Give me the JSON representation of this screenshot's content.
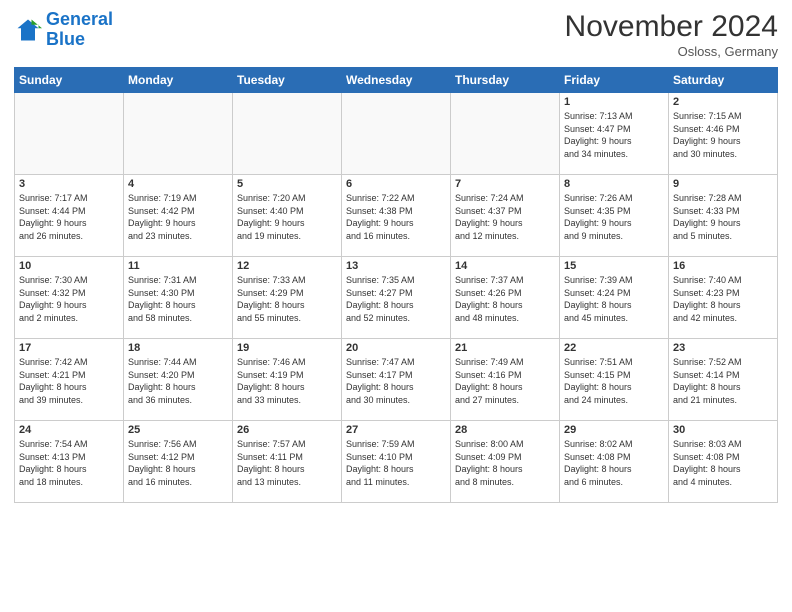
{
  "header": {
    "logo_line1": "General",
    "logo_line2": "Blue",
    "month": "November 2024",
    "location": "Osloss, Germany"
  },
  "weekdays": [
    "Sunday",
    "Monday",
    "Tuesday",
    "Wednesday",
    "Thursday",
    "Friday",
    "Saturday"
  ],
  "weeks": [
    [
      {
        "day": "",
        "info": ""
      },
      {
        "day": "",
        "info": ""
      },
      {
        "day": "",
        "info": ""
      },
      {
        "day": "",
        "info": ""
      },
      {
        "day": "",
        "info": ""
      },
      {
        "day": "1",
        "info": "Sunrise: 7:13 AM\nSunset: 4:47 PM\nDaylight: 9 hours\nand 34 minutes."
      },
      {
        "day": "2",
        "info": "Sunrise: 7:15 AM\nSunset: 4:46 PM\nDaylight: 9 hours\nand 30 minutes."
      }
    ],
    [
      {
        "day": "3",
        "info": "Sunrise: 7:17 AM\nSunset: 4:44 PM\nDaylight: 9 hours\nand 26 minutes."
      },
      {
        "day": "4",
        "info": "Sunrise: 7:19 AM\nSunset: 4:42 PM\nDaylight: 9 hours\nand 23 minutes."
      },
      {
        "day": "5",
        "info": "Sunrise: 7:20 AM\nSunset: 4:40 PM\nDaylight: 9 hours\nand 19 minutes."
      },
      {
        "day": "6",
        "info": "Sunrise: 7:22 AM\nSunset: 4:38 PM\nDaylight: 9 hours\nand 16 minutes."
      },
      {
        "day": "7",
        "info": "Sunrise: 7:24 AM\nSunset: 4:37 PM\nDaylight: 9 hours\nand 12 minutes."
      },
      {
        "day": "8",
        "info": "Sunrise: 7:26 AM\nSunset: 4:35 PM\nDaylight: 9 hours\nand 9 minutes."
      },
      {
        "day": "9",
        "info": "Sunrise: 7:28 AM\nSunset: 4:33 PM\nDaylight: 9 hours\nand 5 minutes."
      }
    ],
    [
      {
        "day": "10",
        "info": "Sunrise: 7:30 AM\nSunset: 4:32 PM\nDaylight: 9 hours\nand 2 minutes."
      },
      {
        "day": "11",
        "info": "Sunrise: 7:31 AM\nSunset: 4:30 PM\nDaylight: 8 hours\nand 58 minutes."
      },
      {
        "day": "12",
        "info": "Sunrise: 7:33 AM\nSunset: 4:29 PM\nDaylight: 8 hours\nand 55 minutes."
      },
      {
        "day": "13",
        "info": "Sunrise: 7:35 AM\nSunset: 4:27 PM\nDaylight: 8 hours\nand 52 minutes."
      },
      {
        "day": "14",
        "info": "Sunrise: 7:37 AM\nSunset: 4:26 PM\nDaylight: 8 hours\nand 48 minutes."
      },
      {
        "day": "15",
        "info": "Sunrise: 7:39 AM\nSunset: 4:24 PM\nDaylight: 8 hours\nand 45 minutes."
      },
      {
        "day": "16",
        "info": "Sunrise: 7:40 AM\nSunset: 4:23 PM\nDaylight: 8 hours\nand 42 minutes."
      }
    ],
    [
      {
        "day": "17",
        "info": "Sunrise: 7:42 AM\nSunset: 4:21 PM\nDaylight: 8 hours\nand 39 minutes."
      },
      {
        "day": "18",
        "info": "Sunrise: 7:44 AM\nSunset: 4:20 PM\nDaylight: 8 hours\nand 36 minutes."
      },
      {
        "day": "19",
        "info": "Sunrise: 7:46 AM\nSunset: 4:19 PM\nDaylight: 8 hours\nand 33 minutes."
      },
      {
        "day": "20",
        "info": "Sunrise: 7:47 AM\nSunset: 4:17 PM\nDaylight: 8 hours\nand 30 minutes."
      },
      {
        "day": "21",
        "info": "Sunrise: 7:49 AM\nSunset: 4:16 PM\nDaylight: 8 hours\nand 27 minutes."
      },
      {
        "day": "22",
        "info": "Sunrise: 7:51 AM\nSunset: 4:15 PM\nDaylight: 8 hours\nand 24 minutes."
      },
      {
        "day": "23",
        "info": "Sunrise: 7:52 AM\nSunset: 4:14 PM\nDaylight: 8 hours\nand 21 minutes."
      }
    ],
    [
      {
        "day": "24",
        "info": "Sunrise: 7:54 AM\nSunset: 4:13 PM\nDaylight: 8 hours\nand 18 minutes."
      },
      {
        "day": "25",
        "info": "Sunrise: 7:56 AM\nSunset: 4:12 PM\nDaylight: 8 hours\nand 16 minutes."
      },
      {
        "day": "26",
        "info": "Sunrise: 7:57 AM\nSunset: 4:11 PM\nDaylight: 8 hours\nand 13 minutes."
      },
      {
        "day": "27",
        "info": "Sunrise: 7:59 AM\nSunset: 4:10 PM\nDaylight: 8 hours\nand 11 minutes."
      },
      {
        "day": "28",
        "info": "Sunrise: 8:00 AM\nSunset: 4:09 PM\nDaylight: 8 hours\nand 8 minutes."
      },
      {
        "day": "29",
        "info": "Sunrise: 8:02 AM\nSunset: 4:08 PM\nDaylight: 8 hours\nand 6 minutes."
      },
      {
        "day": "30",
        "info": "Sunrise: 8:03 AM\nSunset: 4:08 PM\nDaylight: 8 hours\nand 4 minutes."
      }
    ]
  ]
}
